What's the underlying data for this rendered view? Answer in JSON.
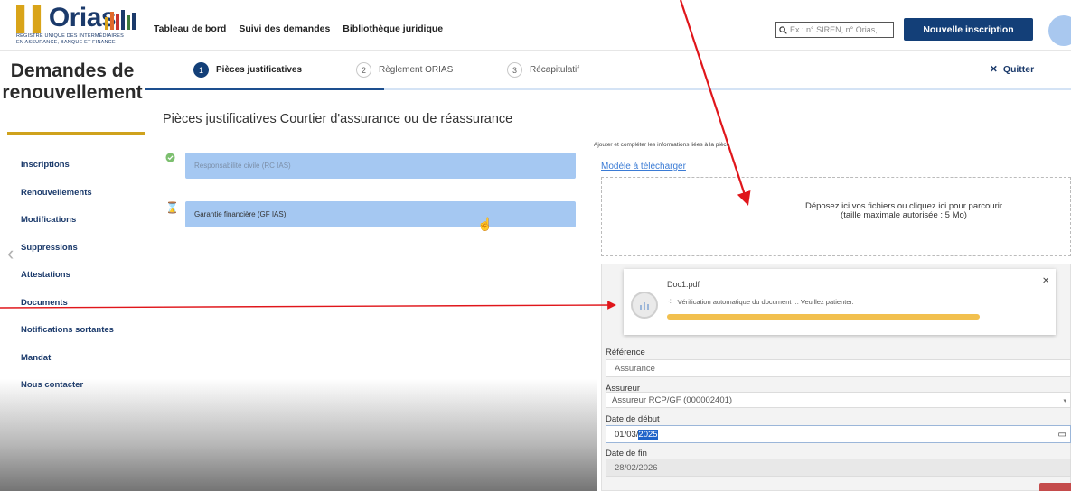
{
  "header": {
    "logo": {
      "word": "Orias",
      "subtitle_line1": "REGISTRE UNIQUE DES INTERMÉDIAIRES",
      "subtitle_line2": "EN ASSURANCE, BANQUE ET FINANCE"
    },
    "nav": [
      "Tableau de bord",
      "Suivi des demandes",
      "Bibliothèque juridique"
    ],
    "search_placeholder": "Ex : n° SIREN, n° Orias, ...",
    "new_button": "Nouvelle inscription"
  },
  "sidebar": {
    "title_line1": "Demandes de",
    "title_line2": "renouvellement",
    "items": [
      "Inscriptions",
      "Renouvellements",
      "Modifications",
      "Suppressions",
      "Attestations",
      "Documents",
      "Notifications sortantes",
      "Mandat",
      "Nous contacter"
    ]
  },
  "stepper": {
    "steps": [
      {
        "num": "1",
        "label": "Pièces justificatives"
      },
      {
        "num": "2",
        "label": "Règlement ORIAS"
      },
      {
        "num": "3",
        "label": "Récapitulatif"
      }
    ],
    "quit_label": "Quitter"
  },
  "main": {
    "section_title": "Pièces justificatives Courtier d'assurance ou de réassurance",
    "documents": [
      {
        "label": "Responsabilité civile (RC IAS)",
        "status": "validated"
      },
      {
        "label": "Garantie financière (GF IAS)",
        "status": "pending"
      }
    ]
  },
  "panel": {
    "legend": "Ajouter et compléter les informations liées à la pièce",
    "template_link": "Modèle à télécharger",
    "dropzone_line1": "Déposez ici vos fichiers ou cliquez ici pour parcourir",
    "dropzone_line2": "(taille maximale autorisée : 5 Mo)",
    "upload": {
      "file_name": "Doc1.pdf",
      "status_text": "Vérification automatique du document ... Veuillez patienter.",
      "progress": 1.0
    },
    "fields": {
      "reference_label": "Référence",
      "reference_value": "Assurance",
      "insurer_label": "Assureur",
      "insurer_value": "Assureur RCP/GF (000002401)",
      "start_label": "Date de début",
      "start_value_prefix": "01/03/",
      "start_value_selected": "2025",
      "end_label": "Date de fin",
      "end_value": "28/02/2026"
    }
  },
  "colors": {
    "brand_navy": "#133f78",
    "brand_gold": "#cfa21d",
    "doc_blue": "#a5c8f2",
    "progress_yellow": "#f2c04e",
    "annotation_red": "#e0161b"
  }
}
